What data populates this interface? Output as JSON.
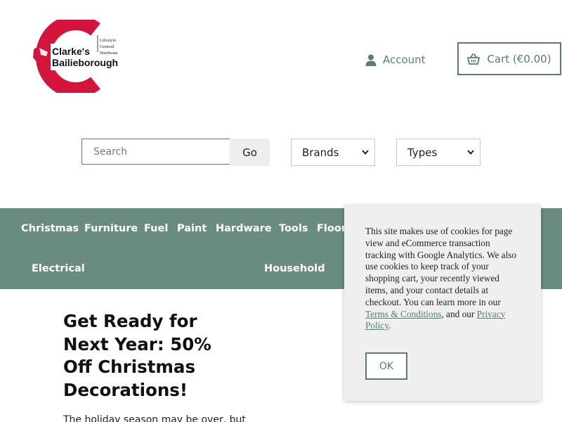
{
  "header": {
    "logo": {
      "line1": "Clarke's",
      "line2": "Bailieborough",
      "tag1": "Lifestyle",
      "tag2": "General",
      "tag3": "Hardware",
      "brand_color": "#d5143c"
    },
    "account_label": "Account",
    "cart_label": "Cart (€0.00)"
  },
  "search": {
    "placeholder": "Search",
    "go_label": "Go",
    "brands_label": "Brands",
    "types_label": "Types"
  },
  "nav": {
    "items": [
      "Christmas",
      "Furniture",
      "Fuel",
      "Paint",
      "Hardware",
      "Tools",
      "Floor",
      "Electrical",
      "Household"
    ]
  },
  "main": {
    "headline": "Get Ready for Next Year: 50% Off Christmas Decorations!",
    "body": "The holiday season may be over, but"
  },
  "cookie": {
    "text_before": "This site makes use of cookies for page view and eCommerce transaction tracking with Google Analytics. We also use cookies to keep track of your shopping cart, your recently viewed items, and your contact details at checkout. You can learn more in our ",
    "terms_link": "Terms & Conditions",
    "text_middle": ", and our ",
    "privacy_link": "Privacy Policy",
    "text_after": ".",
    "ok_label": "OK"
  },
  "colors": {
    "accent": "#5a7d73",
    "nav_background": "#6a8b80",
    "logo_red": "#d5143c"
  }
}
